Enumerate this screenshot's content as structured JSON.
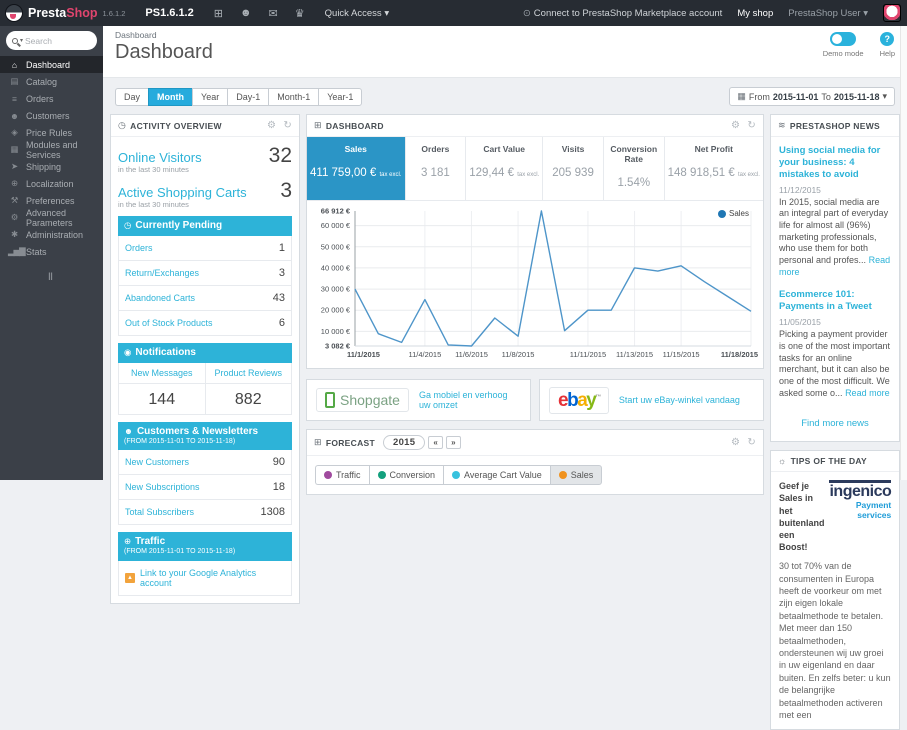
{
  "colors": {
    "accent": "#2db3d8",
    "kpi_active": "#2b95c6",
    "chart_line": "#4e95c9",
    "legend_dot": "#1f77b4",
    "topbar_bg": "#272c33",
    "sidebar_bg": "#3b4048",
    "brand_pink": "#e0456e"
  },
  "icons": {
    "caret": "▾",
    "cart": "⊞",
    "person": "☻",
    "envelope": "✉",
    "trophy": "♛",
    "marketplace": "⊙",
    "calendar": "▦",
    "clock": "◷",
    "bell": "◉",
    "users": "☻",
    "globe": "⊕",
    "gear": "⚙",
    "refresh": "↻",
    "rss": "≋",
    "bulb": "☼",
    "rewind": "«",
    "forward": "»",
    "ga": "▲",
    "help": "?",
    "collapse": "‖",
    "nav": [
      "⌂",
      "▤",
      "≡",
      "☻",
      "◈",
      "▦",
      "➤",
      "⊕",
      "⚒",
      "⚙",
      "✱",
      "▂▅▇"
    ]
  },
  "brand": {
    "name_presta": "Presta",
    "name_shop": "Shop",
    "version_small": "1.6.1.2",
    "version_label": "PS1.6.1.2",
    "quick_access": "Quick Access"
  },
  "topbar": {
    "marketplace_link": "Connect to PrestaShop Marketplace account",
    "my_shop": "My shop",
    "user_menu": "PrestaShop User"
  },
  "sidebar": {
    "search_placeholder": "Search",
    "items": [
      {
        "label": "Dashboard"
      },
      {
        "label": "Catalog"
      },
      {
        "label": "Orders"
      },
      {
        "label": "Customers"
      },
      {
        "label": "Price Rules"
      },
      {
        "label": "Modules and Services"
      },
      {
        "label": "Shipping"
      },
      {
        "label": "Localization"
      },
      {
        "label": "Preferences"
      },
      {
        "label": "Advanced Parameters"
      },
      {
        "label": "Administration"
      },
      {
        "label": "Stats"
      }
    ]
  },
  "header": {
    "breadcrumb": "Dashboard",
    "title": "Dashboard",
    "demo_mode": "Demo mode",
    "help": "Help"
  },
  "filters": {
    "buttons": [
      "Day",
      "Month",
      "Year",
      "Day-1",
      "Month-1",
      "Year-1"
    ],
    "active": "Month",
    "date_range": {
      "from_label": "From",
      "from": "2015-11-01",
      "to_label": "To",
      "to": "2015-11-18"
    }
  },
  "activity": {
    "title": "ACTIVITY OVERVIEW",
    "online_visitors": {
      "label": "Online Visitors",
      "value": "32",
      "sub": "in the last 30 minutes"
    },
    "active_carts": {
      "label": "Active Shopping Carts",
      "value": "3",
      "sub": "in the last 30 minutes"
    },
    "pending": {
      "title": "Currently Pending",
      "rows": [
        {
          "label": "Orders",
          "value": "1"
        },
        {
          "label": "Return/Exchanges",
          "value": "3"
        },
        {
          "label": "Abandoned Carts",
          "value": "43"
        },
        {
          "label": "Out of Stock Products",
          "value": "6"
        }
      ]
    },
    "notifications": {
      "title": "Notifications",
      "cols": [
        {
          "label": "New Messages",
          "value": "144"
        },
        {
          "label": "Product Reviews",
          "value": "882"
        }
      ]
    },
    "customers": {
      "title": "Customers & Newsletters",
      "sub": "(FROM 2015-11-01 TO 2015-11-18)",
      "rows": [
        {
          "label": "New Customers",
          "value": "90"
        },
        {
          "label": "New Subscriptions",
          "value": "18"
        },
        {
          "label": "Total Subscribers",
          "value": "1308"
        }
      ]
    },
    "traffic": {
      "title": "Traffic",
      "sub": "(FROM 2015-11-01 TO 2015-11-18)",
      "link": "Link to your Google Analytics account"
    }
  },
  "dashboard_panel": {
    "title": "DASHBOARD",
    "kpis": [
      {
        "label": "Sales",
        "value": "411 759,00 €",
        "suffix": "tax excl."
      },
      {
        "label": "Orders",
        "value": "3 181",
        "suffix": ""
      },
      {
        "label": "Cart Value",
        "value": "129,44 €",
        "suffix": "tax excl."
      },
      {
        "label": "Visits",
        "value": "205 939",
        "suffix": ""
      },
      {
        "label": "Conversion Rate",
        "value": "1.54%",
        "suffix": ""
      },
      {
        "label": "Net Profit",
        "value": "148 918,51 €",
        "suffix": "tax excl."
      }
    ]
  },
  "chart_data": {
    "type": "line",
    "title": "Sales",
    "ylim": [
      3082,
      66912
    ],
    "grid": true,
    "legend": {
      "label": "Sales",
      "position": "top-right",
      "dot_color": "#1f77b4"
    },
    "series": [
      {
        "name": "Sales",
        "color": "#4e95c9",
        "x": [
          "11/1/2015",
          "11/2/2015",
          "11/3/2015",
          "11/4/2015",
          "11/5/2015",
          "11/6/2015",
          "11/7/2015",
          "11/8/2015",
          "11/9/2015",
          "11/10/2015",
          "11/11/2015",
          "11/12/2015",
          "11/13/2015",
          "11/14/2015",
          "11/15/2015",
          "11/16/2015",
          "11/17/2015",
          "11/18/2015"
        ],
        "values": [
          30000,
          8900,
          4800,
          25000,
          3600,
          3082,
          16300,
          7700,
          66912,
          10300,
          20000,
          20000,
          40000,
          38500,
          41000,
          33500,
          26500,
          19500
        ]
      }
    ],
    "yticks": [
      {
        "label": "3 082 €",
        "value": 3082,
        "bold": true
      },
      {
        "label": "10 000 €",
        "value": 10000
      },
      {
        "label": "20 000 €",
        "value": 20000
      },
      {
        "label": "30 000 €",
        "value": 30000
      },
      {
        "label": "40 000 €",
        "value": 40000
      },
      {
        "label": "50 000 €",
        "value": 50000
      },
      {
        "label": "60 000 €",
        "value": 60000
      },
      {
        "label": "66 912 €",
        "value": 66912,
        "bold": true
      }
    ],
    "xticks": [
      {
        "label": "11/1/2015",
        "index": 0,
        "bold": true
      },
      {
        "label": "11/4/2015",
        "index": 3
      },
      {
        "label": "11/6/2015",
        "index": 5
      },
      {
        "label": "11/8/2015",
        "index": 7
      },
      {
        "label": "11/11/2015",
        "index": 10
      },
      {
        "label": "11/13/2015",
        "index": 12
      },
      {
        "label": "11/15/2015",
        "index": 14
      },
      {
        "label": "11/18/2015",
        "index": 17,
        "bold": true
      }
    ]
  },
  "modules": {
    "shopgate": {
      "logo": "Shopgate",
      "link": "Ga mobiel en verhoog uw omzet"
    },
    "ebay": {
      "logo_letters": [
        {
          "ch": "e",
          "color": "#e53238"
        },
        {
          "ch": "b",
          "color": "#0064d2"
        },
        {
          "ch": "a",
          "color": "#f5af02"
        },
        {
          "ch": "y",
          "color": "#86b817"
        }
      ],
      "tm": "™",
      "link": "Start uw eBay-winkel vandaag"
    }
  },
  "forecast": {
    "title": "FORECAST",
    "year": "2015",
    "legend": [
      {
        "label": "Traffic",
        "color": "#a04a9e"
      },
      {
        "label": "Conversion",
        "color": "#13a07d"
      },
      {
        "label": "Average Cart Value",
        "color": "#38c2de"
      },
      {
        "label": "Sales",
        "color": "#f0921e",
        "active": true
      }
    ]
  },
  "news": {
    "title": "PRESTASHOP NEWS",
    "articles": [
      {
        "title": "Using social media for your business: 4 mistakes to avoid",
        "date": "11/12/2015",
        "excerpt": "In 2015, social media are an integral part of everyday life for almost all (96%) marketing professionals, who use them for both personal and profes...",
        "read_more": "Read more"
      },
      {
        "title": "Ecommerce 101: Payments in a Tweet",
        "date": "11/05/2015",
        "excerpt": "Picking a payment provider is one of the most important tasks for an online merchant, but it can also be one of the most difficult. We asked some o...",
        "read_more": "Read more"
      }
    ],
    "find_more": "Find more news"
  },
  "tips": {
    "title": "TIPS OF THE DAY",
    "headline": "Geef je Sales in het buitenland een Boost!",
    "logo_main": "ingenico",
    "logo_sub": "Payment services",
    "body": "30 tot 70% van de consumenten in Europa heeft de voorkeur om met zijn eigen lokale betaalmethode te betalen. Met meer dan 150 betaalmethoden, ondersteunen wij uw groei in uw eigenland en daar buiten. En zelfs beter: u kun de belangrijke betaalmethoden activeren met een"
  }
}
